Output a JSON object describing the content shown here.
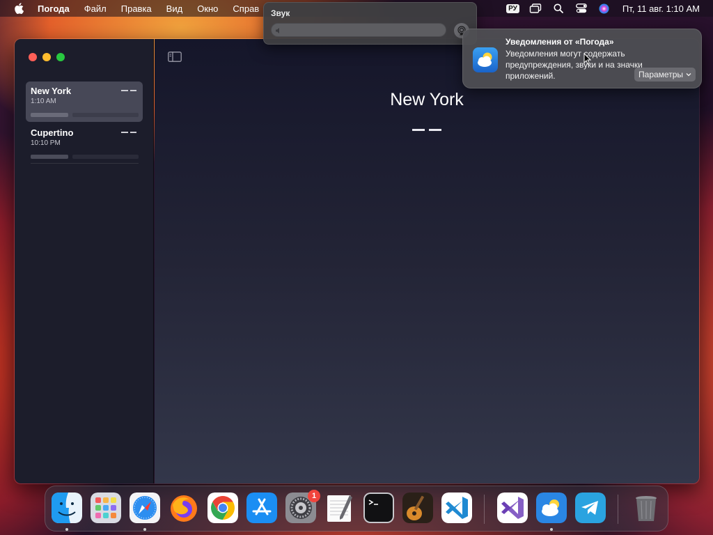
{
  "menubar": {
    "app_name": "Погода",
    "items": [
      "Файл",
      "Правка",
      "Вид",
      "Окно",
      "Справ"
    ],
    "input_source": "РУ",
    "clock": "Пт, 11 авг.  1:10 AM"
  },
  "sound_popup": {
    "title": "Звук",
    "volume": 0
  },
  "notification": {
    "title": "Уведомления от «Погода»",
    "body": "Уведомления могут содержать предупреждения, звуки и на значки приложений.",
    "action_label": "Параметры"
  },
  "sidebar": {
    "cities": [
      {
        "name": "New York",
        "time": "1:10 AM",
        "temperature": "– –",
        "selected": true
      },
      {
        "name": "Cupertino",
        "time": "10:10 PM",
        "temperature": "– –",
        "selected": false
      }
    ]
  },
  "main": {
    "city": "New York",
    "temperature": "– –"
  },
  "dock": {
    "apps": [
      {
        "name": "Finder",
        "icon": "finder-icon",
        "running": true
      },
      {
        "name": "Launchpad",
        "icon": "launchpad-icon",
        "running": false
      },
      {
        "name": "Safari",
        "icon": "safari-icon",
        "running": true
      },
      {
        "name": "Firefox",
        "icon": "firefox-icon",
        "running": false
      },
      {
        "name": "Google Chrome",
        "icon": "chrome-icon",
        "running": false
      },
      {
        "name": "App Store",
        "icon": "app-store-icon",
        "running": false
      },
      {
        "name": "System Settings",
        "icon": "settings-icon",
        "running": false,
        "badge": "1"
      },
      {
        "name": "TextEdit",
        "icon": "textedit-icon",
        "running": false
      },
      {
        "name": "Terminal",
        "icon": "terminal-icon",
        "running": false
      },
      {
        "name": "GarageBand",
        "icon": "garageband-icon",
        "running": false
      },
      {
        "name": "Visual Studio Code",
        "icon": "vscode-icon",
        "running": false
      },
      {
        "name": "Visual Studio",
        "icon": "visual-studio-icon",
        "running": false
      },
      {
        "name": "Weather",
        "icon": "weather-icon",
        "running": true
      },
      {
        "name": "Telegram",
        "icon": "telegram-icon",
        "running": false
      },
      {
        "name": "Trash",
        "icon": "trash-icon",
        "running": false
      }
    ]
  },
  "colors": {
    "accent_red": "#fe5f57",
    "accent_yellow": "#febc2e",
    "accent_green": "#28c840",
    "badge": "#f1453d"
  }
}
